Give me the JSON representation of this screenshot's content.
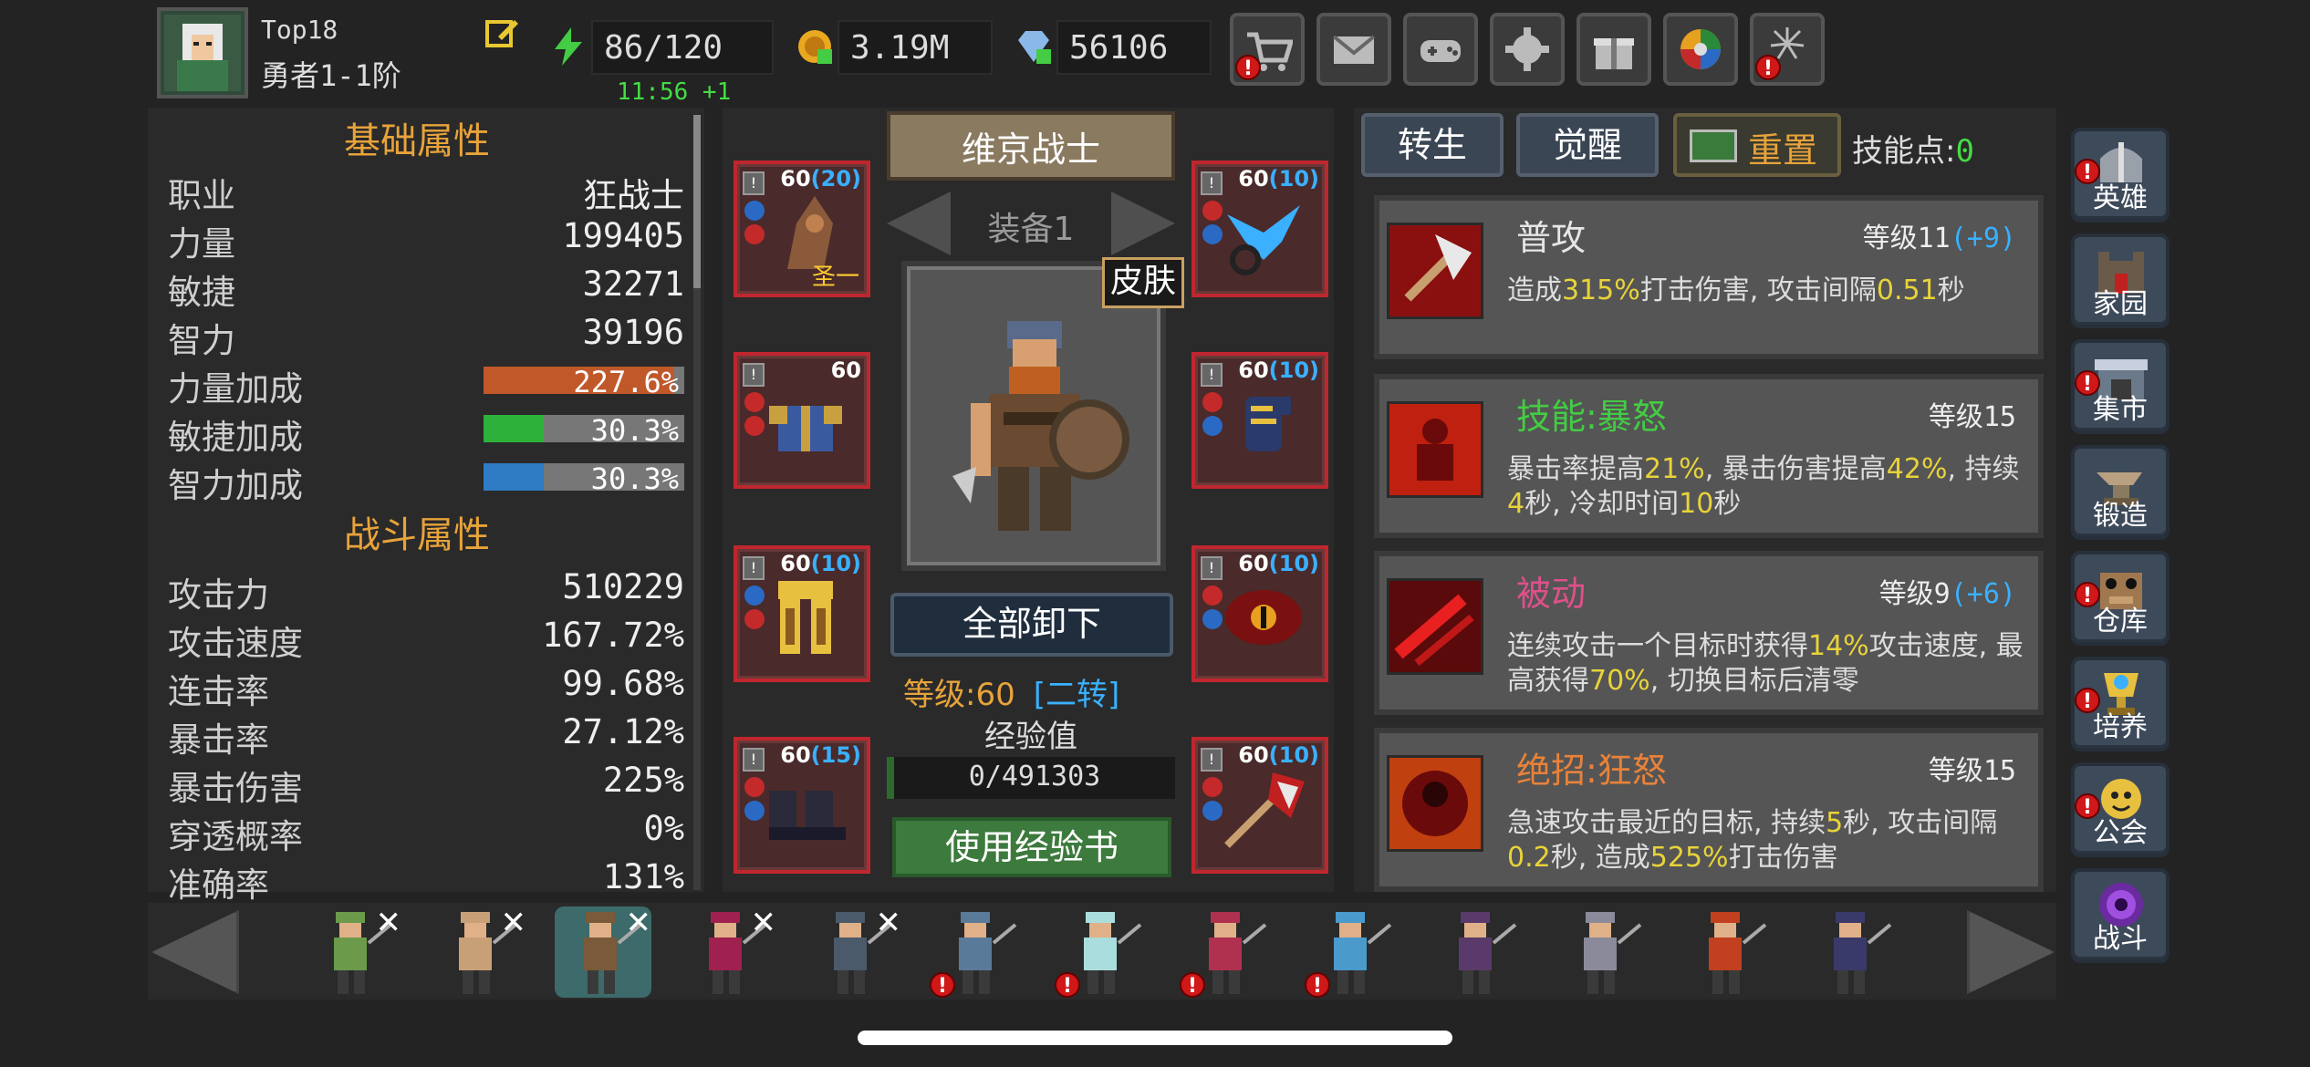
{
  "player": {
    "name": "Top18",
    "rank": "勇者1-1阶"
  },
  "resources": {
    "energy": "86/120",
    "energy_timer": "11:56 +1",
    "gold": "3.19M",
    "diamonds": "56106"
  },
  "top_buttons": [
    {
      "name": "shop",
      "icon": "cart-icon",
      "alert": "!"
    },
    {
      "name": "mail",
      "icon": "envelope-icon",
      "alert": ""
    },
    {
      "name": "games",
      "icon": "gamepad-icon",
      "alert": ""
    },
    {
      "name": "settings",
      "icon": "gear-icon",
      "alert": ""
    },
    {
      "name": "gifts",
      "icon": "gift-icon",
      "alert": ""
    },
    {
      "name": "lucky-wheel",
      "icon": "color-wheel-icon",
      "alert": ""
    },
    {
      "name": "fireworks",
      "icon": "fireworks-icon",
      "alert": "!"
    }
  ],
  "basic_stats": {
    "title": "基础属性",
    "rows": [
      {
        "label": "职业",
        "value": "狂战士"
      },
      {
        "label": "力量",
        "value": "199405"
      },
      {
        "label": "敏捷",
        "value": "32271"
      },
      {
        "label": "智力",
        "value": "39196"
      }
    ],
    "bonus_rows": [
      {
        "label": "力量加成",
        "value": "227.6%",
        "fill": 0.95,
        "color": "#c0582a"
      },
      {
        "label": "敏捷加成",
        "value": "30.3%",
        "fill": 0.3,
        "color": "#2db13a"
      },
      {
        "label": "智力加成",
        "value": "30.3%",
        "fill": 0.3,
        "color": "#2f7cc4"
      }
    ]
  },
  "combat_stats": {
    "title": "战斗属性",
    "rows": [
      {
        "label": "攻击力",
        "value": "510229"
      },
      {
        "label": "攻击速度",
        "value": "167.72%"
      },
      {
        "label": "连击率",
        "value": "99.68%"
      },
      {
        "label": "暴击率",
        "value": "27.12%"
      },
      {
        "label": "暴击伤害",
        "value": "225%"
      },
      {
        "label": "穿透概率",
        "value": "0%"
      },
      {
        "label": "准确率",
        "value": "131%"
      }
    ]
  },
  "hero": {
    "name": "维京战士",
    "equip_set": "装备1",
    "skin_label": "皮肤",
    "unequip_all": "全部卸下",
    "level": "等级:60",
    "transfer": "[二转]",
    "exp_label": "经验值",
    "exp_value": "0/491303",
    "use_exp_book": "使用经验书"
  },
  "equipment": {
    "left": [
      {
        "level": "60",
        "plus": "(20)",
        "tag": "圣一"
      },
      {
        "level": "60",
        "plus": "",
        "tag": ""
      },
      {
        "level": "60",
        "plus": "(10)",
        "tag": ""
      },
      {
        "level": "60",
        "plus": "(15)",
        "tag": ""
      }
    ],
    "right": [
      {
        "level": "60",
        "plus": "(10)"
      },
      {
        "level": "60",
        "plus": "(10)"
      },
      {
        "level": "60",
        "plus": "(10)"
      },
      {
        "level": "60",
        "plus": "(10)"
      }
    ]
  },
  "skill_tabs": {
    "rebirth": "转生",
    "awaken": "觉醒",
    "reset": "重置",
    "skill_points_label": "技能点:",
    "skill_points": "0"
  },
  "skills": [
    {
      "name": "普攻",
      "name_color": "#e6e6e6",
      "level": "等级11",
      "plus": "(+9)",
      "desc": [
        "造成",
        "315%",
        "打击伤害, 攻击间隔",
        "0.51",
        "秒"
      ]
    },
    {
      "name": "技能:暴怒",
      "name_color": "#44cc44",
      "level": "等级15",
      "plus": "",
      "desc": [
        "暴击率提高",
        "21%",
        ", 暴击伤害提高",
        "42%",
        ", 持续",
        "4",
        "秒, 冷却时间",
        "10",
        "秒"
      ]
    },
    {
      "name": "被动",
      "name_color": "#e0508a",
      "level": "等级9",
      "plus": "(+6)",
      "desc": [
        "连续攻击一个目标时获得",
        "14%",
        "攻击速度, 最高获得",
        "70%",
        ", 切换目标后清零"
      ]
    },
    {
      "name": "绝招:狂怒",
      "name_color": "#e8823a",
      "level": "等级15",
      "plus": "",
      "desc": [
        "急速攻击最近的目标, 持续",
        "5",
        "秒, 攻击间隔",
        "0.2",
        "秒, 造成",
        "525%",
        "打击伤害"
      ]
    }
  ],
  "side_nav": [
    {
      "label": "英雄",
      "icon": "helmet-icon",
      "alert": "!"
    },
    {
      "label": "家园",
      "icon": "castle-icon",
      "alert": ""
    },
    {
      "label": "集市",
      "icon": "market-icon",
      "alert": "!"
    },
    {
      "label": "锻造",
      "icon": "anvil-icon",
      "alert": ""
    },
    {
      "label": "仓库",
      "icon": "warehouse-icon",
      "alert": "!"
    },
    {
      "label": "培养",
      "icon": "trophy-icon",
      "alert": "!"
    },
    {
      "label": "公会",
      "icon": "guild-icon",
      "alert": "!"
    },
    {
      "label": "战斗",
      "icon": "portal-icon",
      "alert": ""
    }
  ],
  "hero_roster": [
    {
      "name": "elf-archer",
      "remove": "✕",
      "alert": "",
      "color": "#6a9a4a"
    },
    {
      "name": "amazon",
      "remove": "✕",
      "alert": "",
      "color": "#c8a078"
    },
    {
      "name": "viking",
      "remove": "✕",
      "alert": "",
      "color": "#7a5a3a",
      "selected": true
    },
    {
      "name": "sorceress",
      "remove": "✕",
      "alert": "",
      "color": "#a02050"
    },
    {
      "name": "rogue",
      "remove": "✕",
      "alert": "",
      "color": "#4a5a6a"
    },
    {
      "name": "gunner",
      "remove": "",
      "alert": "!",
      "color": "#5a7a9a"
    },
    {
      "name": "ghost",
      "remove": "",
      "alert": "!",
      "color": "#aadddd"
    },
    {
      "name": "vampire",
      "remove": "",
      "alert": "!",
      "color": "#b03050"
    },
    {
      "name": "ice-mage",
      "remove": "",
      "alert": "!",
      "color": "#4a9acc"
    },
    {
      "name": "warlock",
      "remove": "",
      "alert": "",
      "color": "#5a3a6a"
    },
    {
      "name": "knight",
      "remove": "",
      "alert": "",
      "color": "#8a8a9a"
    },
    {
      "name": "fire-demon",
      "remove": "",
      "alert": "",
      "color": "#c04020"
    },
    {
      "name": "dark-knight",
      "remove": "",
      "alert": "",
      "color": "#3a3a6a"
    }
  ]
}
